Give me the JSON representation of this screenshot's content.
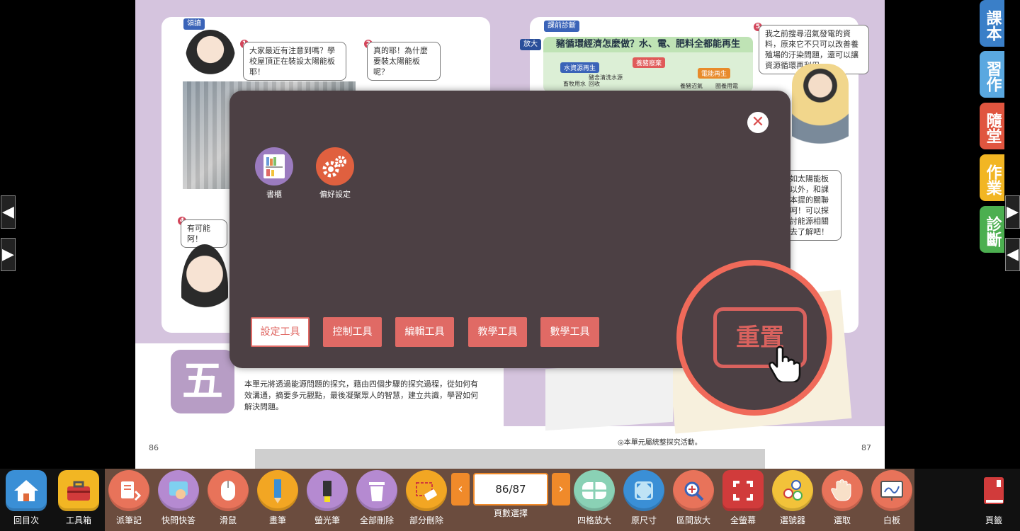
{
  "book": {
    "left_page": {
      "tag": "領讀",
      "bubble1_num": "1",
      "bubble1": "大家最近有注意到嗎？學校屋頂正在裝設太陽能板耶！",
      "bubble2_num": "2",
      "bubble2": "真的耶！為什麼要裝太陽能板呢？",
      "bubble4_num": "4",
      "bubble4": "有可能阿！",
      "page_number": "86",
      "unit_char": "五",
      "intro": "本單元將透過能源問題的探究，藉由四個步驟的探究過程，從如何有效溝通，摘要多元觀點，最後凝聚眾人的智慧，建立共識，學習如何解決問題。"
    },
    "right_page": {
      "tag": "課前診斷",
      "zoom_tag": "放大",
      "heading": "豬循環經濟怎麼做？水、電、肥料全都能再生",
      "labels": [
        "水資源再生",
        "養豬廢棄",
        "電能再生"
      ],
      "small_texts": [
        "豬舍清洗水源回收",
        "畜牧用水",
        "養豬沼氣",
        "圈養用電"
      ],
      "bubble5_num": "5",
      "bubble5": "我之前搜尋沼氣發電的資料，原來它不只可以改善養殖場的汙染問題，還可以讓資源循環再利用。",
      "bubble6": "如太陽能板以外，和課本提的關聯呵！可以探討能源相關去了解吧！",
      "footnote": "◎本單元屬統整探究活動。",
      "page_number": "87"
    }
  },
  "side_tabs": [
    {
      "label": "課本",
      "color": "#3a7fc8"
    },
    {
      "label": "習作",
      "color": "#5aa8e0"
    },
    {
      "label": "隨堂",
      "color": "#e0553f"
    },
    {
      "label": "作業",
      "color": "#f2b623"
    },
    {
      "label": "診斷",
      "color": "#4caf50"
    }
  ],
  "nav_arrows": {
    "prev": "◀",
    "next": "▶"
  },
  "modal": {
    "close_symbol": "✕",
    "tools": [
      {
        "label": "書櫃",
        "icon": "bookshelf-icon"
      },
      {
        "label": "偏好設定",
        "icon": "gears-icon"
      }
    ],
    "tabs": [
      {
        "label": "設定工具",
        "active": true
      },
      {
        "label": "控制工具",
        "active": false
      },
      {
        "label": "編輯工具",
        "active": false
      },
      {
        "label": "教學工具",
        "active": false
      },
      {
        "label": "數學工具",
        "active": false
      }
    ],
    "reset_label": "重置"
  },
  "toolbar": {
    "home": "回目次",
    "toolbox": "工具箱",
    "items": [
      {
        "label": "派筆記",
        "icon": "note-dispatch-icon"
      },
      {
        "label": "快問快答",
        "icon": "quick-answer-icon"
      },
      {
        "label": "滑鼠",
        "icon": "mouse-icon"
      },
      {
        "label": "畫筆",
        "icon": "pen-icon"
      },
      {
        "label": "螢光筆",
        "icon": "highlighter-icon"
      },
      {
        "label": "全部刪除",
        "icon": "trash-icon"
      },
      {
        "label": "部分刪除",
        "icon": "eraser-icon"
      }
    ],
    "page_selector": {
      "value": "86/87",
      "label": "頁數選擇",
      "prev": "‹",
      "next": "›"
    },
    "items2": [
      {
        "label": "四格放大",
        "icon": "quad-zoom-icon"
      },
      {
        "label": "原尺寸",
        "icon": "original-size-icon"
      },
      {
        "label": "區間放大",
        "icon": "area-zoom-icon"
      },
      {
        "label": "全螢幕",
        "icon": "fullscreen-icon"
      },
      {
        "label": "選號器",
        "icon": "number-picker-icon"
      },
      {
        "label": "選取",
        "icon": "hand-select-icon"
      },
      {
        "label": "白板",
        "icon": "whiteboard-icon"
      }
    ],
    "bookmark": "頁籤"
  }
}
